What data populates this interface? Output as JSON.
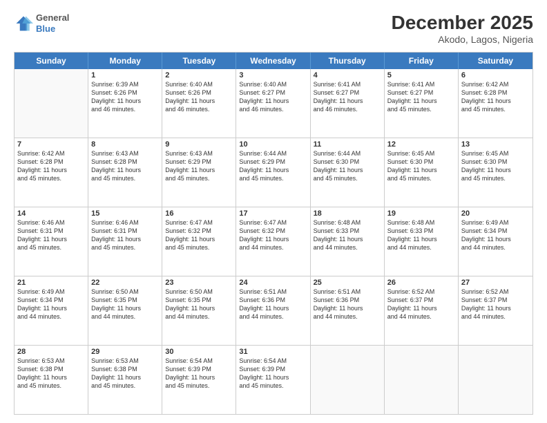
{
  "header": {
    "logo_line1": "General",
    "logo_line2": "Blue",
    "title": "December 2025",
    "subtitle": "Akodo, Lagos, Nigeria"
  },
  "days_of_week": [
    "Sunday",
    "Monday",
    "Tuesday",
    "Wednesday",
    "Thursday",
    "Friday",
    "Saturday"
  ],
  "weeks": [
    [
      {
        "day": "",
        "info": ""
      },
      {
        "day": "1",
        "info": "Sunrise: 6:39 AM\nSunset: 6:26 PM\nDaylight: 11 hours\nand 46 minutes."
      },
      {
        "day": "2",
        "info": "Sunrise: 6:40 AM\nSunset: 6:26 PM\nDaylight: 11 hours\nand 46 minutes."
      },
      {
        "day": "3",
        "info": "Sunrise: 6:40 AM\nSunset: 6:27 PM\nDaylight: 11 hours\nand 46 minutes."
      },
      {
        "day": "4",
        "info": "Sunrise: 6:41 AM\nSunset: 6:27 PM\nDaylight: 11 hours\nand 46 minutes."
      },
      {
        "day": "5",
        "info": "Sunrise: 6:41 AM\nSunset: 6:27 PM\nDaylight: 11 hours\nand 45 minutes."
      },
      {
        "day": "6",
        "info": "Sunrise: 6:42 AM\nSunset: 6:28 PM\nDaylight: 11 hours\nand 45 minutes."
      }
    ],
    [
      {
        "day": "7",
        "info": "Sunrise: 6:42 AM\nSunset: 6:28 PM\nDaylight: 11 hours\nand 45 minutes."
      },
      {
        "day": "8",
        "info": "Sunrise: 6:43 AM\nSunset: 6:28 PM\nDaylight: 11 hours\nand 45 minutes."
      },
      {
        "day": "9",
        "info": "Sunrise: 6:43 AM\nSunset: 6:29 PM\nDaylight: 11 hours\nand 45 minutes."
      },
      {
        "day": "10",
        "info": "Sunrise: 6:44 AM\nSunset: 6:29 PM\nDaylight: 11 hours\nand 45 minutes."
      },
      {
        "day": "11",
        "info": "Sunrise: 6:44 AM\nSunset: 6:30 PM\nDaylight: 11 hours\nand 45 minutes."
      },
      {
        "day": "12",
        "info": "Sunrise: 6:45 AM\nSunset: 6:30 PM\nDaylight: 11 hours\nand 45 minutes."
      },
      {
        "day": "13",
        "info": "Sunrise: 6:45 AM\nSunset: 6:30 PM\nDaylight: 11 hours\nand 45 minutes."
      }
    ],
    [
      {
        "day": "14",
        "info": "Sunrise: 6:46 AM\nSunset: 6:31 PM\nDaylight: 11 hours\nand 45 minutes."
      },
      {
        "day": "15",
        "info": "Sunrise: 6:46 AM\nSunset: 6:31 PM\nDaylight: 11 hours\nand 45 minutes."
      },
      {
        "day": "16",
        "info": "Sunrise: 6:47 AM\nSunset: 6:32 PM\nDaylight: 11 hours\nand 45 minutes."
      },
      {
        "day": "17",
        "info": "Sunrise: 6:47 AM\nSunset: 6:32 PM\nDaylight: 11 hours\nand 44 minutes."
      },
      {
        "day": "18",
        "info": "Sunrise: 6:48 AM\nSunset: 6:33 PM\nDaylight: 11 hours\nand 44 minutes."
      },
      {
        "day": "19",
        "info": "Sunrise: 6:48 AM\nSunset: 6:33 PM\nDaylight: 11 hours\nand 44 minutes."
      },
      {
        "day": "20",
        "info": "Sunrise: 6:49 AM\nSunset: 6:34 PM\nDaylight: 11 hours\nand 44 minutes."
      }
    ],
    [
      {
        "day": "21",
        "info": "Sunrise: 6:49 AM\nSunset: 6:34 PM\nDaylight: 11 hours\nand 44 minutes."
      },
      {
        "day": "22",
        "info": "Sunrise: 6:50 AM\nSunset: 6:35 PM\nDaylight: 11 hours\nand 44 minutes."
      },
      {
        "day": "23",
        "info": "Sunrise: 6:50 AM\nSunset: 6:35 PM\nDaylight: 11 hours\nand 44 minutes."
      },
      {
        "day": "24",
        "info": "Sunrise: 6:51 AM\nSunset: 6:36 PM\nDaylight: 11 hours\nand 44 minutes."
      },
      {
        "day": "25",
        "info": "Sunrise: 6:51 AM\nSunset: 6:36 PM\nDaylight: 11 hours\nand 44 minutes."
      },
      {
        "day": "26",
        "info": "Sunrise: 6:52 AM\nSunset: 6:37 PM\nDaylight: 11 hours\nand 44 minutes."
      },
      {
        "day": "27",
        "info": "Sunrise: 6:52 AM\nSunset: 6:37 PM\nDaylight: 11 hours\nand 44 minutes."
      }
    ],
    [
      {
        "day": "28",
        "info": "Sunrise: 6:53 AM\nSunset: 6:38 PM\nDaylight: 11 hours\nand 45 minutes."
      },
      {
        "day": "29",
        "info": "Sunrise: 6:53 AM\nSunset: 6:38 PM\nDaylight: 11 hours\nand 45 minutes."
      },
      {
        "day": "30",
        "info": "Sunrise: 6:54 AM\nSunset: 6:39 PM\nDaylight: 11 hours\nand 45 minutes."
      },
      {
        "day": "31",
        "info": "Sunrise: 6:54 AM\nSunset: 6:39 PM\nDaylight: 11 hours\nand 45 minutes."
      },
      {
        "day": "",
        "info": ""
      },
      {
        "day": "",
        "info": ""
      },
      {
        "day": "",
        "info": ""
      }
    ]
  ]
}
